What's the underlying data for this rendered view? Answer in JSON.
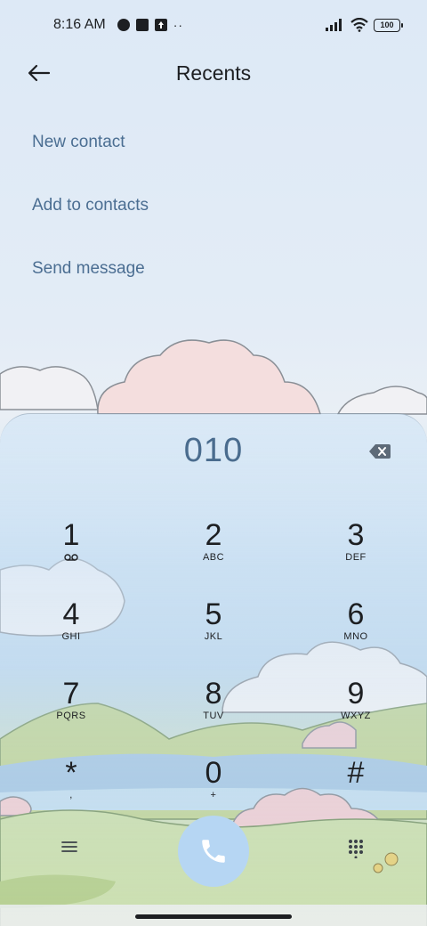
{
  "status_bar": {
    "time": "8:16 AM",
    "battery": "100",
    "icons": [
      "wallet-icon",
      "app-square-icon",
      "upload-icon",
      "more-dots-icon",
      "signal-icon",
      "wifi-icon",
      "battery-icon"
    ]
  },
  "header": {
    "title": "Recents",
    "back_icon": "back-arrow-icon"
  },
  "actions": [
    {
      "label": "New contact"
    },
    {
      "label": "Add to contacts"
    },
    {
      "label": "Send message"
    }
  ],
  "dialpad": {
    "number": "010",
    "keys": [
      {
        "digit": "1",
        "letters": ""
      },
      {
        "digit": "2",
        "letters": "ABC"
      },
      {
        "digit": "3",
        "letters": "DEF"
      },
      {
        "digit": "4",
        "letters": "GHI"
      },
      {
        "digit": "5",
        "letters": "JKL"
      },
      {
        "digit": "6",
        "letters": "MNO"
      },
      {
        "digit": "7",
        "letters": "PQRS"
      },
      {
        "digit": "8",
        "letters": "TUV"
      },
      {
        "digit": "9",
        "letters": "WXYZ"
      },
      {
        "digit": "*",
        "letters": ","
      },
      {
        "digit": "0",
        "letters": "+"
      },
      {
        "digit": "#",
        "letters": ""
      }
    ]
  },
  "colors": {
    "accent": "#4b6e92",
    "call_button": "#b6d6f3",
    "text": "#1d1f22"
  }
}
